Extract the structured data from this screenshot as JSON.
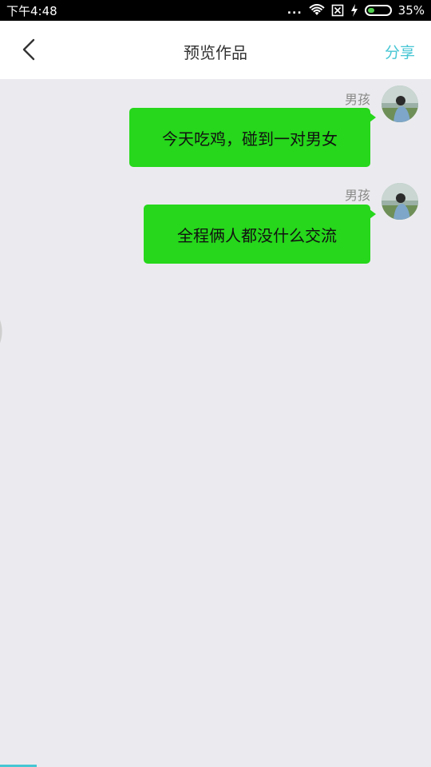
{
  "status_bar": {
    "time": "下午4:48",
    "signal_dots": "...",
    "battery_percent": "35%",
    "battery_level": 0.35,
    "icons": [
      "wifi-icon",
      "sim-off-icon",
      "charging-icon",
      "battery-icon"
    ]
  },
  "header": {
    "back_icon": "chevron-left-icon",
    "title": "预览作品",
    "share_label": "分享"
  },
  "messages": [
    {
      "sender": "男孩",
      "text": "今天吃鸡，碰到一对男女"
    },
    {
      "sender": "男孩",
      "text": "全程俩人都没什么交流"
    }
  ],
  "colors": {
    "bubble": "#26d71b",
    "accent": "#47c6d4",
    "background": "#ebebef"
  }
}
